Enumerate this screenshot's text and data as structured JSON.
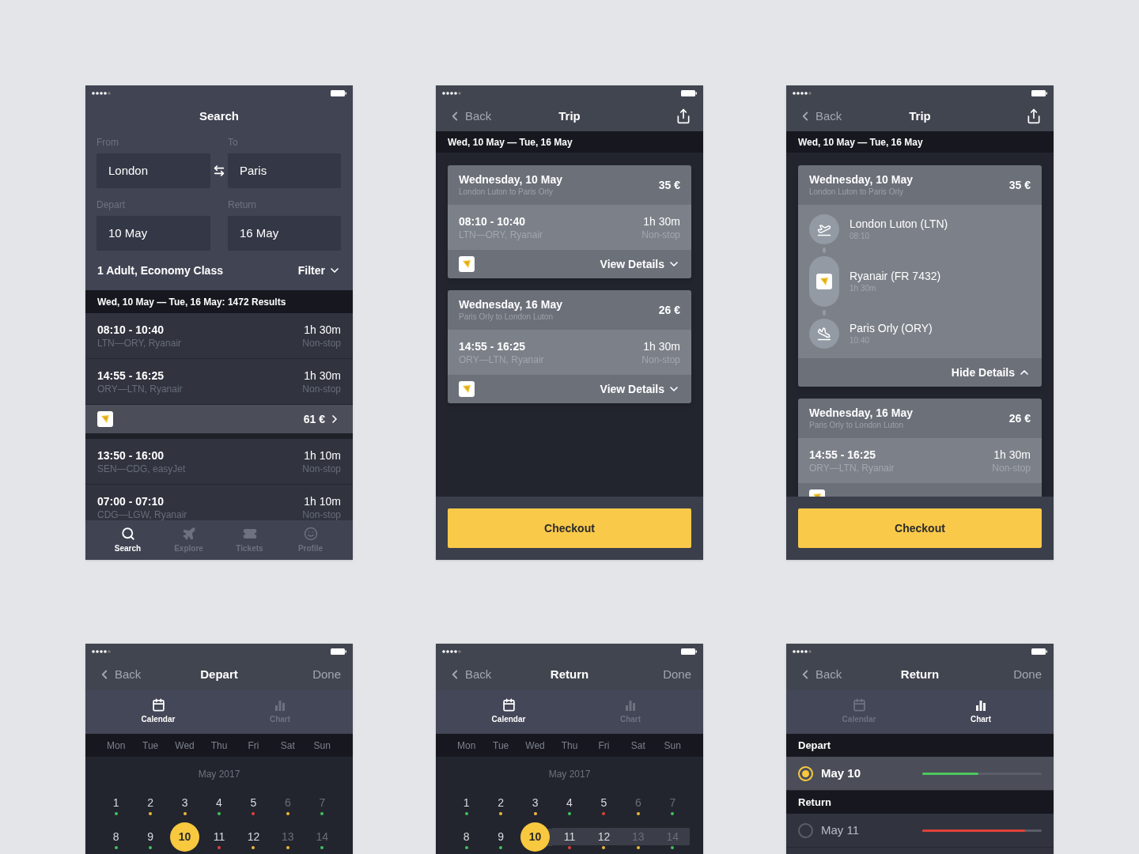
{
  "screens": [
    {
      "kind": "search",
      "title": "Search",
      "fields": [
        {
          "label": "From",
          "value": "London"
        },
        {
          "label": "To",
          "value": "Paris"
        },
        {
          "label": "Depart",
          "value": "10 May"
        },
        {
          "label": "Return",
          "value": "16 May"
        }
      ],
      "passengers": "1 Adult, Economy Class",
      "filter": "Filter",
      "summary": "Wed, 10 May — Tue, 16 May: 1472 Results",
      "results": [
        {
          "kind": "flight",
          "times": "08:10 - 10:40",
          "route": "LTN—ORY, Ryanair",
          "duration": "1h 30m",
          "stops": "Non-stop"
        },
        {
          "kind": "flight",
          "times": "14:55 - 16:25",
          "route": "ORY—LTN, Ryanair",
          "duration": "1h 30m",
          "stops": "Non-stop"
        },
        {
          "kind": "price",
          "price": "61 €"
        },
        {
          "kind": "flight",
          "times": "13:50 - 16:00",
          "route": "SEN—CDG, easyJet",
          "duration": "1h 10m",
          "stops": "Non-stop"
        },
        {
          "kind": "flight",
          "times": "07:00 - 07:10",
          "route": "CDG—LGW, Ryanair",
          "duration": "1h 10m",
          "stops": "Non-stop"
        }
      ],
      "tabs": [
        {
          "kind": "search",
          "label": "Search",
          "selected": true
        },
        {
          "kind": "explore",
          "label": "Explore",
          "selected": false
        },
        {
          "kind": "tickets",
          "label": "Tickets",
          "selected": false
        },
        {
          "kind": "profile",
          "label": "Profile",
          "selected": false
        }
      ]
    },
    {
      "kind": "trip",
      "back": "Back",
      "title": "Trip",
      "dates": "Wed, 10 May — Tue, 16 May",
      "legs": [
        {
          "date": "Wednesday, 10 May",
          "route": "London Luton to Paris Orly",
          "price": "35 €",
          "expanded": false,
          "times": "08:10 - 10:40",
          "path": "LTN—ORY, Ryanair",
          "duration": "1h 30m",
          "stops": "Non-stop",
          "toggle": "View Details"
        },
        {
          "date": "Wednesday, 16 May",
          "route": "Paris Orly to London Luton",
          "price": "26 €",
          "expanded": false,
          "times": "14:55 - 16:25",
          "path": "ORY—LTN, Ryanair",
          "duration": "1h 30m",
          "stops": "Non-stop",
          "toggle": "View Details"
        }
      ],
      "checkout": "Checkout"
    },
    {
      "kind": "trip",
      "back": "Back",
      "title": "Trip",
      "dates": "Wed, 10 May — Tue, 16 May",
      "legs": [
        {
          "date": "Wednesday, 10 May",
          "route": "London Luton to Paris Orly",
          "price": "35 €",
          "expanded": true,
          "details": [
            {
              "kind": "takeoff",
              "name": "London Luton (LTN)",
              "sub": "08:10"
            },
            {
              "kind": "airline",
              "name": "Ryanair (FR 7432)",
              "sub": "1h 30m"
            },
            {
              "kind": "landing",
              "name": "Paris Orly (ORY)",
              "sub": "10:40"
            }
          ],
          "toggle": "Hide Details"
        },
        {
          "date": "Wednesday, 16 May",
          "route": "Paris Orly to London Luton",
          "price": "26 €",
          "expanded": false,
          "times": "14:55 - 16:25",
          "path": "ORY—LTN, Ryanair",
          "duration": "1h 30m",
          "stops": "Non-stop"
        }
      ],
      "checkout": "Checkout"
    },
    {
      "kind": "calendar",
      "back": "Back",
      "title": "Depart",
      "done": "Done",
      "views": [
        {
          "kind": "calendar",
          "label": "Calendar",
          "selected": true
        },
        {
          "kind": "chart",
          "label": "Chart",
          "selected": false
        }
      ],
      "weekdays": [
        "Mon",
        "Tue",
        "Wed",
        "Thu",
        "Fri",
        "Sat",
        "Sun"
      ],
      "month": "May 2017",
      "days": [
        {
          "day": "1",
          "color": "#3fc35a",
          "dimmed": false,
          "selected": false,
          "in_range": false
        },
        {
          "day": "2",
          "color": "#f0b93a",
          "dimmed": false,
          "selected": false,
          "in_range": false
        },
        {
          "day": "3",
          "color": "#f0b93a",
          "dimmed": false,
          "selected": false,
          "in_range": false
        },
        {
          "day": "4",
          "color": "#3fc35a",
          "dimmed": false,
          "selected": false,
          "in_range": false
        },
        {
          "day": "5",
          "color": "#e0413a",
          "dimmed": false,
          "selected": false,
          "in_range": false
        },
        {
          "day": "6",
          "color": "#f0b93a",
          "dimmed": true,
          "selected": false,
          "in_range": false
        },
        {
          "day": "7",
          "color": "#3fc35a",
          "dimmed": true,
          "selected": false,
          "in_range": false
        },
        {
          "day": "8",
          "color": "#3fc35a",
          "dimmed": false,
          "selected": false,
          "in_range": false
        },
        {
          "day": "9",
          "color": "#3fc35a",
          "dimmed": false,
          "selected": false,
          "in_range": false
        },
        {
          "day": "10",
          "selected": true
        },
        {
          "day": "11",
          "color": "#e0413a",
          "dimmed": false,
          "selected": false,
          "in_range": false
        },
        {
          "day": "12",
          "color": "#f0b93a",
          "dimmed": false,
          "selected": false,
          "in_range": false
        },
        {
          "day": "13",
          "color": "#f0b93a",
          "dimmed": true,
          "selected": false,
          "in_range": false
        },
        {
          "day": "14",
          "color": "#3fc35a",
          "dimmed": true,
          "selected": false,
          "in_range": false
        }
      ]
    },
    {
      "kind": "calendar",
      "back": "Back",
      "title": "Return",
      "done": "Done",
      "views": [
        {
          "kind": "calendar",
          "label": "Calendar",
          "selected": true
        },
        {
          "kind": "chart",
          "label": "Chart",
          "selected": false
        }
      ],
      "weekdays": [
        "Mon",
        "Tue",
        "Wed",
        "Thu",
        "Fri",
        "Sat",
        "Sun"
      ],
      "month": "May 2017",
      "days": [
        {
          "day": "1",
          "color": "#3fc35a",
          "dimmed": false,
          "selected": false,
          "in_range": false
        },
        {
          "day": "2",
          "color": "#f0b93a",
          "dimmed": false,
          "selected": false,
          "in_range": false
        },
        {
          "day": "3",
          "color": "#f0b93a",
          "dimmed": false,
          "selected": false,
          "in_range": false
        },
        {
          "day": "4",
          "color": "#3fc35a",
          "dimmed": false,
          "selected": false,
          "in_range": false
        },
        {
          "day": "5",
          "color": "#e0413a",
          "dimmed": false,
          "selected": false,
          "in_range": false
        },
        {
          "day": "6",
          "color": "#f0b93a",
          "dimmed": true,
          "selected": false,
          "in_range": false
        },
        {
          "day": "7",
          "color": "#3fc35a",
          "dimmed": true,
          "selected": false,
          "in_range": false
        },
        {
          "day": "8",
          "color": "#3fc35a",
          "dimmed": false,
          "selected": false,
          "in_range": false
        },
        {
          "day": "9",
          "color": "#3fc35a",
          "dimmed": false,
          "selected": false,
          "in_range": false
        },
        {
          "day": "10",
          "selected": true
        },
        {
          "day": "11",
          "color": "#e0413a",
          "dimmed": false,
          "selected": false,
          "in_range": true
        },
        {
          "day": "12",
          "color": "#f0b93a",
          "dimmed": false,
          "selected": false,
          "in_range": true
        },
        {
          "day": "13",
          "color": "#f0b93a",
          "dimmed": true,
          "selected": false,
          "in_range": true
        },
        {
          "day": "14",
          "color": "#3fc35a",
          "dimmed": true,
          "selected": false,
          "in_range": true
        }
      ]
    },
    {
      "kind": "chart",
      "back": "Back",
      "title": "Return",
      "done": "Done",
      "views": [
        {
          "kind": "calendar",
          "label": "Calendar",
          "selected": false
        },
        {
          "kind": "chart",
          "label": "Chart",
          "selected": true
        }
      ],
      "sections": [
        {
          "heading": "Depart",
          "options": [
            {
              "label": "May 10",
              "selected": true,
              "level": 0.47,
              "color": "#4cc95f"
            }
          ]
        },
        {
          "heading": "Return",
          "options": [
            {
              "label": "May 11",
              "selected": false,
              "level": 0.86,
              "color": "#e0413a"
            }
          ]
        }
      ]
    }
  ]
}
